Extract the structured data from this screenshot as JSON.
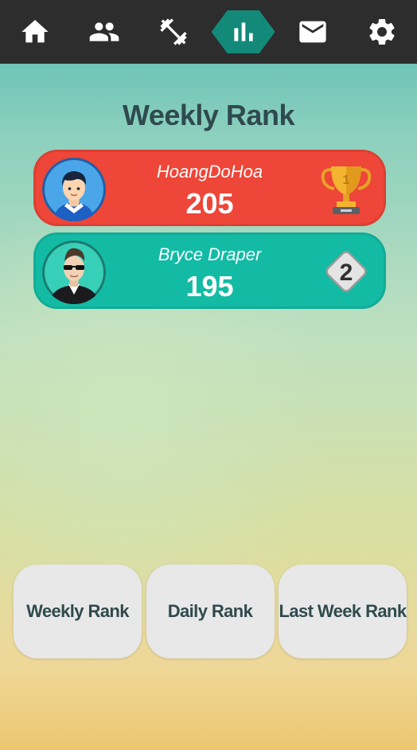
{
  "nav": {
    "items": [
      {
        "icon": "home-icon",
        "active": false
      },
      {
        "icon": "friends-icon",
        "active": false
      },
      {
        "icon": "dumbbell-icon",
        "active": false
      },
      {
        "icon": "bar-chart-icon",
        "active": true
      },
      {
        "icon": "mail-icon",
        "active": false
      },
      {
        "icon": "gear-icon",
        "active": false
      }
    ]
  },
  "title": "Weekly Rank",
  "ranking": [
    {
      "name": "HoangDoHoa",
      "score": "205",
      "rank": "1",
      "badge": "trophy-icon",
      "color": "#ee4638"
    },
    {
      "name": "Bryce Draper",
      "score": "195",
      "rank": "2",
      "badge": "diamond-badge-icon",
      "color": "#13bba5"
    }
  ],
  "buttons": {
    "weekly": "Weekly Rank",
    "daily": "Daily Rank",
    "last_week": "Last Week Rank"
  },
  "colors": {
    "topbar": "#2d2d2d",
    "active_tab": "#138a79",
    "title": "#2f4a4e",
    "button_bg": "#e8e8e8"
  }
}
